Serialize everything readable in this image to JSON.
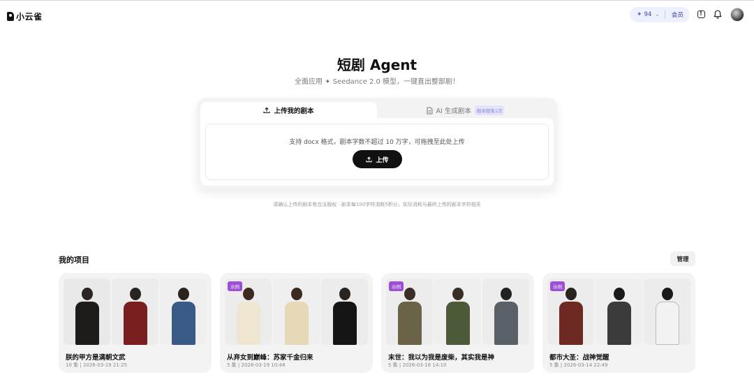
{
  "header": {
    "logo_text": "小云雀",
    "credits": "94",
    "member_label": "会员",
    "icons": [
      "info-icon",
      "bell-icon"
    ]
  },
  "hero": {
    "title": "短剧 Agent",
    "subtitle": "全面应用 ✦ Seedance 2.0 模型，一键直出整部剧！"
  },
  "upload": {
    "tab_upload": "上传我的剧本",
    "tab_ai": "AI 生成剧本",
    "tab_ai_badge": "剧本限免1次",
    "drop_text": "支持 docx 格式，剧本字数不超过 10 万字，可拖拽至此处上传",
    "button_label": "上传"
  },
  "notice": "请确认上传的剧本有合法版权 · 剧本每100字符消耗5积分，实际消耗与最终上传的剧本字符相关",
  "projects": {
    "title": "我的项目",
    "manage_label": "管理",
    "items": [
      {
        "name": "朕的甲方是满朝文武",
        "meta": "10 集 | 2026-03-19 21:25",
        "badge": ""
      },
      {
        "name": "从弃女到巅峰：苏家千金归来",
        "meta": "5 集 | 2026-03-19 10:48",
        "badge": "示例"
      },
      {
        "name": "末世：我以为我是废柴，其实我是神",
        "meta": "5 集 | 2026-03-16 14:10",
        "badge": "示例"
      },
      {
        "name": "都市大圣：战神觉醒",
        "meta": "5 集 | 2026-03-14 22:49",
        "badge": "示例"
      }
    ]
  },
  "colors": {
    "accent": "#5b5fe0",
    "badge": "#9b4fd6",
    "button": "#111111"
  }
}
